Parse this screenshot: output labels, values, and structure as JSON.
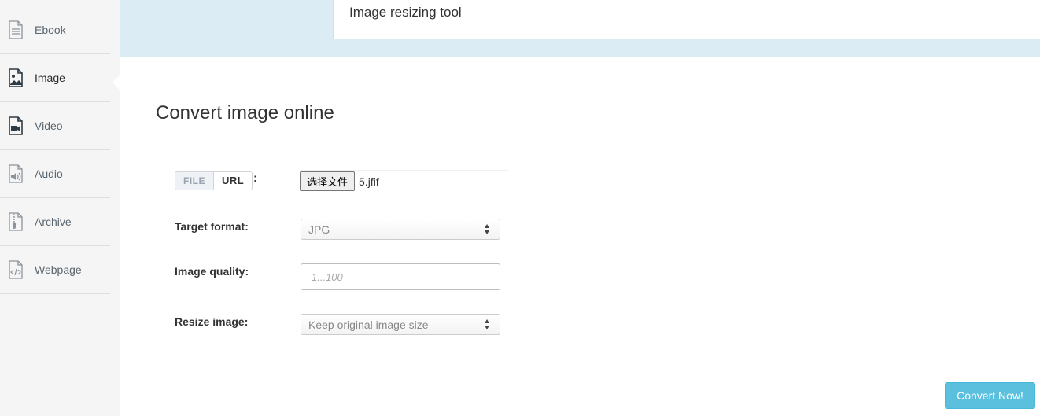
{
  "sidebar": {
    "items": [
      {
        "label": "Ebook",
        "icon": "document-icon"
      },
      {
        "label": "Image",
        "icon": "image-icon",
        "active": true
      },
      {
        "label": "Video",
        "icon": "video-icon"
      },
      {
        "label": "Audio",
        "icon": "audio-icon"
      },
      {
        "label": "Archive",
        "icon": "archive-icon"
      },
      {
        "label": "Webpage",
        "icon": "code-icon"
      }
    ]
  },
  "banner": {
    "text": "Image resizing tool"
  },
  "main": {
    "title": "Convert image online",
    "source": {
      "file_tab": "FILE",
      "url_tab": "URL",
      "colon": ":",
      "choose_file_button": "选择文件",
      "file_name": "5.jfif"
    },
    "target_format": {
      "label": "Target format:",
      "value": "JPG"
    },
    "image_quality": {
      "label": "Image quality:",
      "placeholder": "1...100"
    },
    "resize_image": {
      "label": "Resize image:",
      "value": "Keep original image size"
    },
    "convert_button": "Convert Now!"
  },
  "colors": {
    "sidebar_bg": "#f5f5f5",
    "banner_bg": "#dcecf5",
    "accent": "#5bc0de"
  }
}
